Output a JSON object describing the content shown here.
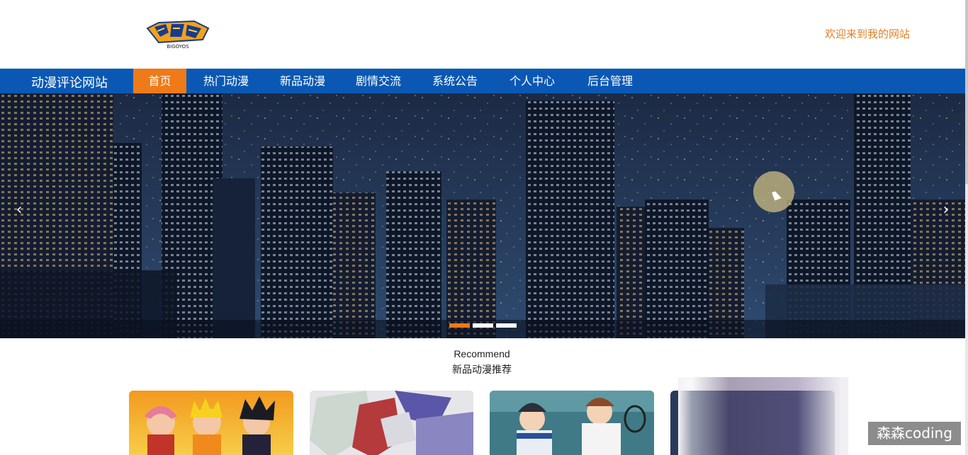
{
  "header": {
    "logo_text": "BIGOYOS",
    "welcome": "欢迎来到我的网站"
  },
  "nav": {
    "brand": "动漫评论网站",
    "items": [
      {
        "label": "首页",
        "active": true
      },
      {
        "label": "热门动漫",
        "active": false
      },
      {
        "label": "新品动漫",
        "active": false
      },
      {
        "label": "剧情交流",
        "active": false
      },
      {
        "label": "系统公告",
        "active": false
      },
      {
        "label": "个人中心",
        "active": false
      },
      {
        "label": "后台管理",
        "active": false
      }
    ],
    "color": "#0a58b4",
    "active_color": "#ee7a18"
  },
  "carousel": {
    "prev_icon": "chevron-left-icon",
    "next_icon": "chevron-right-icon",
    "slide_count": 3,
    "active_slide": 1
  },
  "section": {
    "title_en": "Recommend",
    "title_cn": "新品动漫推荐"
  },
  "cards": [
    {
      "name": "naruto-card"
    },
    {
      "name": "gundam-card"
    },
    {
      "name": "tennis-card"
    },
    {
      "name": "blurred-card"
    }
  ],
  "watermark": "森森coding"
}
